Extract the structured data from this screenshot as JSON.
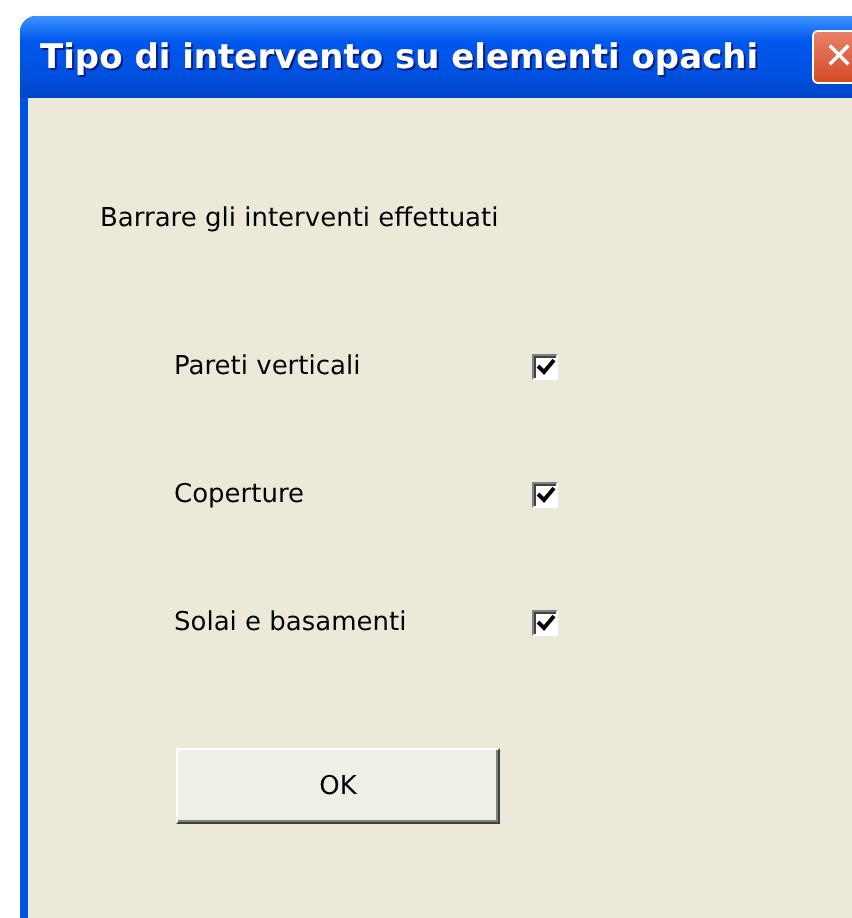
{
  "window": {
    "title": "Tipo di intervento su elementi opachi",
    "close": "✕"
  },
  "instruction": "Barrare gli interventi effettuati",
  "options": [
    {
      "label": "Pareti verticali",
      "checked": true
    },
    {
      "label": "Coperture",
      "checked": true
    },
    {
      "label": "Solai e basamenti",
      "checked": true
    }
  ],
  "buttons": [
    "OK"
  ]
}
